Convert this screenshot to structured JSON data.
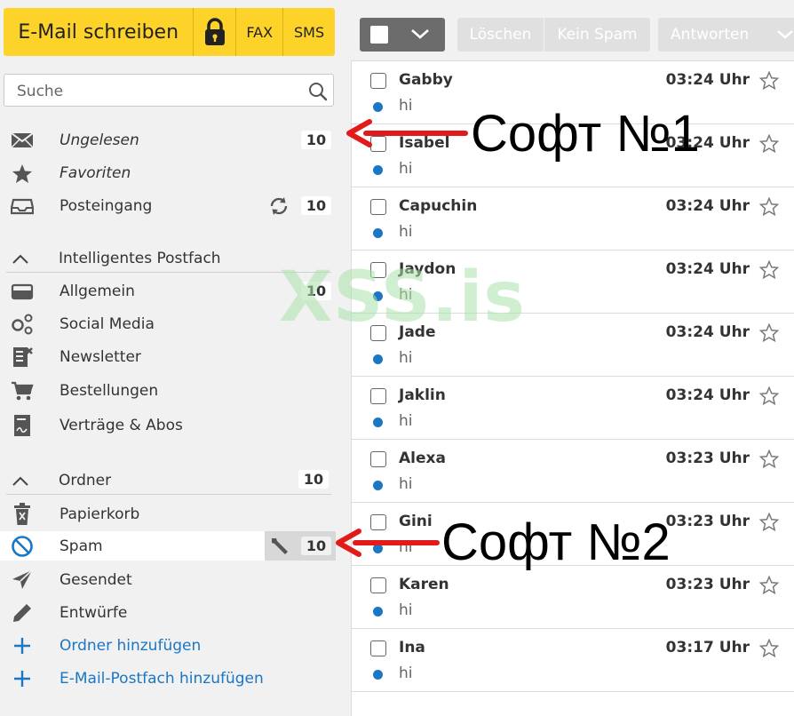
{
  "compose": {
    "write_label": "E-Mail schreiben",
    "fax_label": "FAX",
    "sms_label": "SMS"
  },
  "search": {
    "placeholder": "Suche"
  },
  "quick": [
    {
      "label": "Ungelesen",
      "count": "10",
      "icon": "envelope-icon"
    },
    {
      "label": "Favoriten",
      "icon": "star-icon"
    },
    {
      "label": "Posteingang",
      "count": "10",
      "icon": "inbox-icon"
    }
  ],
  "smart": {
    "title": "Intelligentes Postfach",
    "items": [
      {
        "label": "Allgemein",
        "count": "10",
        "icon": "tray-icon"
      },
      {
        "label": "Social Media",
        "icon": "social-icon"
      },
      {
        "label": "Newsletter",
        "icon": "newsletter-icon"
      },
      {
        "label": "Bestellungen",
        "icon": "cart-icon"
      },
      {
        "label": "Verträge & Abos",
        "icon": "contract-icon"
      }
    ]
  },
  "folders": {
    "title": "Ordner",
    "count": "10",
    "items": [
      {
        "label": "Papierkorb",
        "icon": "trash-icon"
      },
      {
        "label": "Spam",
        "count": "10",
        "icon": "block-icon"
      },
      {
        "label": "Gesendet",
        "icon": "send-icon"
      },
      {
        "label": "Entwürfe",
        "icon": "pencil-icon"
      }
    ],
    "add_folder": "Ordner hinzufügen",
    "add_mailbox": "E-Mail-Postfach hinzufügen"
  },
  "toolbar": {
    "delete_label": "Löschen",
    "not_spam_label": "Kein Spam",
    "reply_label": "Antworten"
  },
  "mails": [
    {
      "sender": "Gabby",
      "time": "03:24 Uhr",
      "subject": "hi"
    },
    {
      "sender": "Isabel",
      "time": "03:24 Uhr",
      "subject": "hi"
    },
    {
      "sender": "Capuchin",
      "time": "03:24 Uhr",
      "subject": "hi"
    },
    {
      "sender": "Jaydon",
      "time": "03:24 Uhr",
      "subject": "hi"
    },
    {
      "sender": "Jade",
      "time": "03:24 Uhr",
      "subject": "hi"
    },
    {
      "sender": "Jaklin",
      "time": "03:24 Uhr",
      "subject": "hi"
    },
    {
      "sender": "Alexa",
      "time": "03:23 Uhr",
      "subject": "hi"
    },
    {
      "sender": "Gini",
      "time": "03:23 Uhr",
      "subject": "hi"
    },
    {
      "sender": "Karen",
      "time": "03:23 Uhr",
      "subject": "hi"
    },
    {
      "sender": "Ina",
      "time": "03:17 Uhr",
      "subject": "hi"
    }
  ],
  "overlay": {
    "watermark": "XSS.is",
    "annotation_1": "Софт №1",
    "annotation_2": "Софт №2"
  },
  "colors": {
    "compose_yellow": "#fdd32a",
    "link_blue": "#1b76c4",
    "arrow_red": "#e21a1a"
  }
}
